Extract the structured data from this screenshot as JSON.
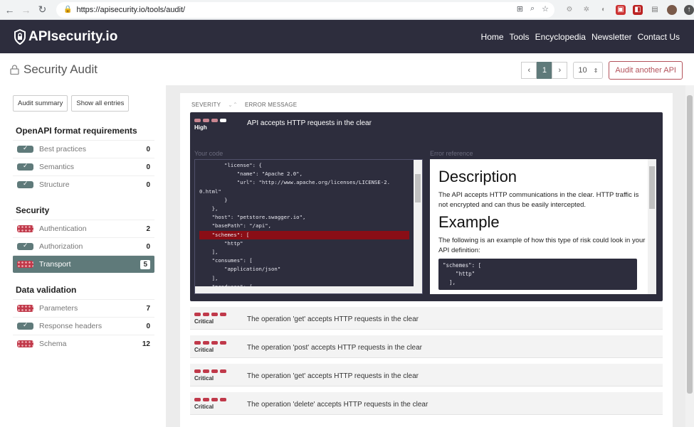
{
  "browser": {
    "url": "https://apisecurity.io/tools/audit/"
  },
  "header": {
    "logo_text": "APIsecurity.io",
    "nav": [
      "Home",
      "Tools",
      "Encyclopedia",
      "Newsletter",
      "Contact Us"
    ]
  },
  "titlebar": {
    "title": "Security Audit",
    "pager": {
      "prev": "‹",
      "current": "1",
      "next": "›"
    },
    "per_page": "10",
    "audit_another": "Audit another API"
  },
  "sidebar": {
    "audit_summary": "Audit summary",
    "show_all": "Show all entries",
    "openapi_title": "OpenAPI format requirements",
    "openapi_items": [
      {
        "label": "Best practices",
        "count": "0",
        "status": "ok"
      },
      {
        "label": "Semantics",
        "count": "0",
        "status": "ok"
      },
      {
        "label": "Structure",
        "count": "0",
        "status": "ok"
      }
    ],
    "security_title": "Security",
    "security_items": [
      {
        "label": "Authentication",
        "count": "2",
        "status": "bad"
      },
      {
        "label": "Authorization",
        "count": "0",
        "status": "ok"
      },
      {
        "label": "Transport",
        "count": "5",
        "status": "bad",
        "active": true
      }
    ],
    "data_title": "Data validation",
    "data_items": [
      {
        "label": "Parameters",
        "count": "7",
        "status": "bad"
      },
      {
        "label": "Response headers",
        "count": "0",
        "status": "ok"
      },
      {
        "label": "Schema",
        "count": "12",
        "status": "bad"
      }
    ]
  },
  "content": {
    "col_severity": "SEVERITY",
    "col_sort": "⌄⌃",
    "col_error": "ERROR MESSAGE",
    "open_issue": {
      "severity": "High",
      "message": "API accepts HTTP requests in the clear",
      "your_code_label": "Your code",
      "code_lines": [
        "        \"license\": {",
        "            \"name\": \"Apache 2.0\",",
        "            \"url\": \"http://www.apache.org/licenses/LICENSE-2.",
        "0.html\"",
        "        }",
        "    },",
        "    \"host\": \"petstore.swagger.io\",",
        "    \"basePath\": \"/api\",",
        "    \"schemes\": [",
        "        \"http\"",
        "    ],",
        "    \"consumes\": [",
        "        \"application/json\"",
        "    ],",
        "    \"produces\": ["
      ],
      "highlight_line": 8,
      "error_ref_label": "Error reference",
      "desc_heading": "Description",
      "desc_text": "The API accepts HTTP communications in the clear. HTTP traffic is not encrypted and can thus be easily intercepted.",
      "example_heading": "Example",
      "example_text": "The following is an example of how this type of risk could look in your API definition:",
      "example_code": "\"schemes\": [\n    \"http\"\n  ],"
    },
    "issues": [
      {
        "severity": "Critical",
        "message": "The operation 'get' accepts HTTP requests in the clear"
      },
      {
        "severity": "Critical",
        "message": "The operation 'post' accepts HTTP requests in the clear"
      },
      {
        "severity": "Critical",
        "message": "The operation 'get' accepts HTTP requests in the clear"
      },
      {
        "severity": "Critical",
        "message": "The operation 'delete' accepts HTTP requests in the clear"
      }
    ]
  }
}
